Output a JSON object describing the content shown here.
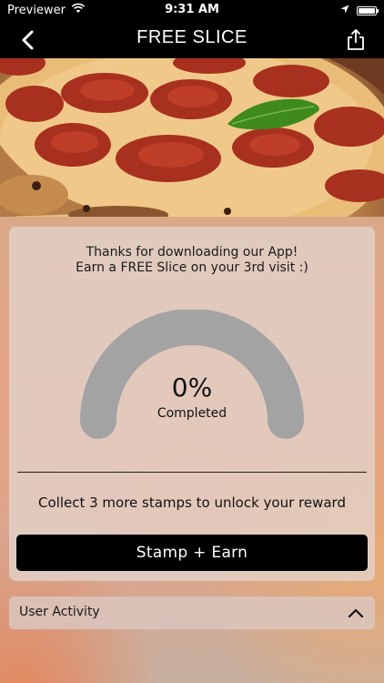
{
  "status_bar": {
    "carrier": "Previewer",
    "time": "9:31 AM"
  },
  "nav": {
    "title": "FREE SLICE"
  },
  "reward": {
    "intro_line1": "Thanks for downloading our App!",
    "intro_line2": "Earn a FREE Slice on your 3rd visit :)",
    "progress_percent": 0,
    "progress_label": "0%",
    "progress_caption": "Completed",
    "collect_text": "Collect 3 more stamps to unlock your reward",
    "button_label": "Stamp + Earn"
  },
  "activity": {
    "label": "User Activity"
  },
  "colors": {
    "bar_bg": "#000000",
    "gauge_track": "#a3a3a3",
    "button_bg": "#000000"
  },
  "icons": {
    "back": "chevron-left-icon",
    "share": "share-icon",
    "activity_toggle": "chevron-up-icon",
    "wifi": "wifi-icon",
    "location": "location-arrow-icon",
    "battery": "battery-icon"
  }
}
